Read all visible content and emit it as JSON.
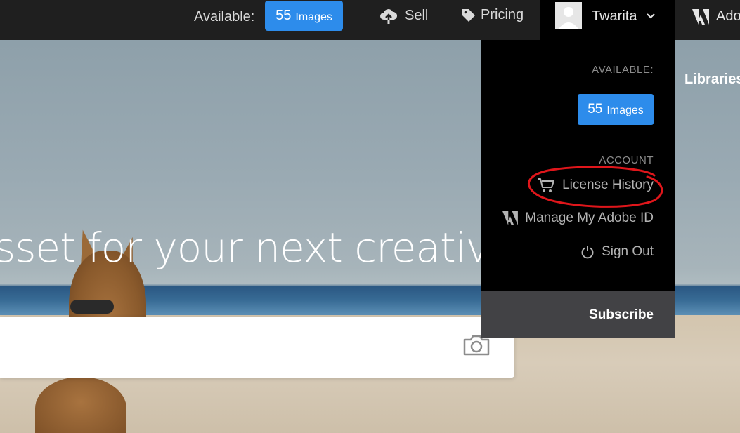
{
  "header": {
    "available_label": "Available:",
    "badge_count": "55",
    "badge_unit": "Images",
    "sell_label": "Sell",
    "pricing_label": "Pricing",
    "user_name": "Twarita",
    "adobe_label": "Adobe"
  },
  "hero": {
    "title": "sset for your next creative proj",
    "libraries_label": "Libraries"
  },
  "dropdown": {
    "available_label": "AVAILABLE:",
    "badge_count": "55",
    "badge_unit": "Images",
    "account_label": "ACCOUNT",
    "license_history": "License History",
    "manage_adobe_id": "Manage My Adobe ID",
    "sign_out": "Sign Out",
    "subscribe": "Subscribe"
  },
  "icons": {
    "sell": "cloud-upload-icon",
    "pricing": "tag-icon",
    "avatar": "user-avatar",
    "chevron": "chevron-down-icon",
    "adobe": "adobe-logo-icon",
    "cart": "cart-icon",
    "power": "power-icon",
    "camera": "camera-icon"
  },
  "colors": {
    "accent": "#2d8ceb",
    "topbar": "#1f1f1f",
    "dropdown": "#000000",
    "subscribe_bg": "#424245",
    "annotation": "#e0161b"
  }
}
